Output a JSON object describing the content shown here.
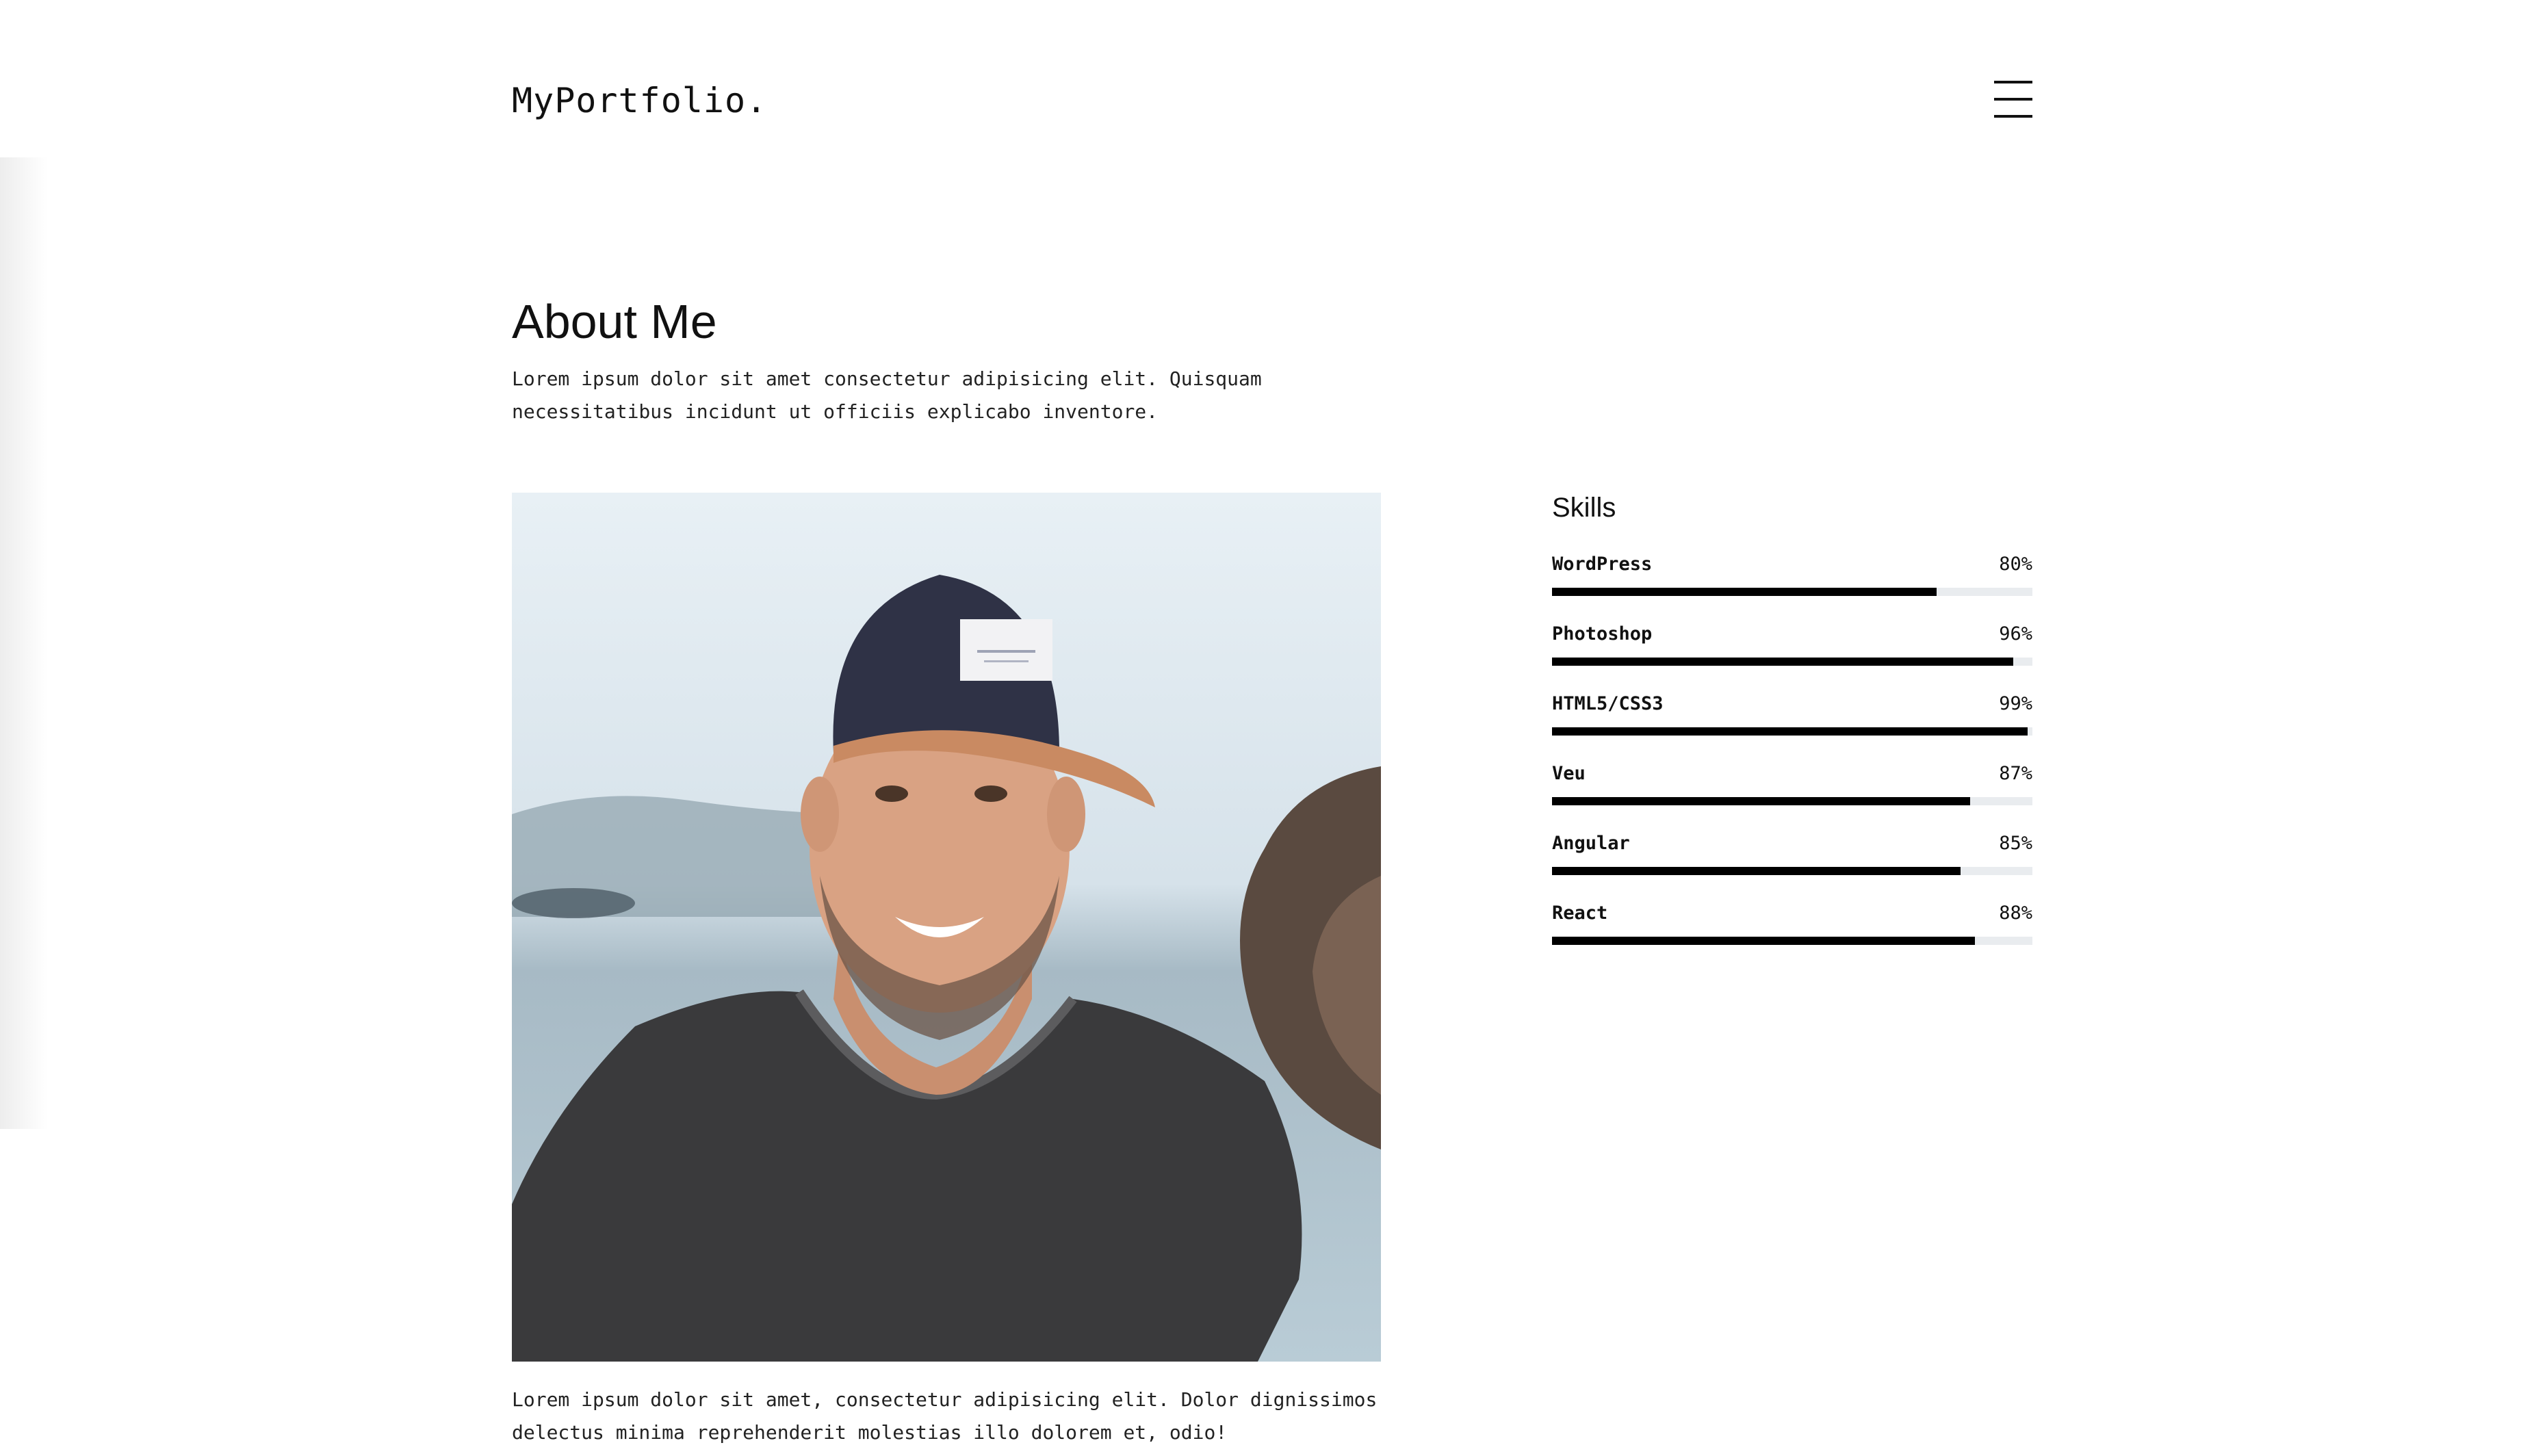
{
  "header": {
    "logo": "MyPortfolio.",
    "menu_icon": "hamburger-menu-icon"
  },
  "about": {
    "title": "About Me",
    "intro": "Lorem ipsum dolor sit amet consectetur adipisicing elit. Quisquam necessitatibus incidunt ut officiis explicabo inventore.",
    "caption": "Lorem ipsum dolor sit amet, consectetur adipisicing elit. Dolor dignissimos delectus minima reprehenderit molestias illo dolorem et, odio!"
  },
  "skills": {
    "title": "Skills",
    "items": [
      {
        "name": "WordPress",
        "percent_label": "80%",
        "value": 80
      },
      {
        "name": "Photoshop",
        "percent_label": "96%",
        "value": 96
      },
      {
        "name": "HTML5/CSS3",
        "percent_label": "99%",
        "value": 99
      },
      {
        "name": "Veu",
        "percent_label": "87%",
        "value": 87
      },
      {
        "name": "Angular",
        "percent_label": "85%",
        "value": 85
      },
      {
        "name": "React",
        "percent_label": "88%",
        "value": 88
      }
    ]
  },
  "colors": {
    "text": "#111111",
    "bar_fill": "#000000",
    "bar_track": "#e9ecef",
    "background": "#ffffff"
  }
}
